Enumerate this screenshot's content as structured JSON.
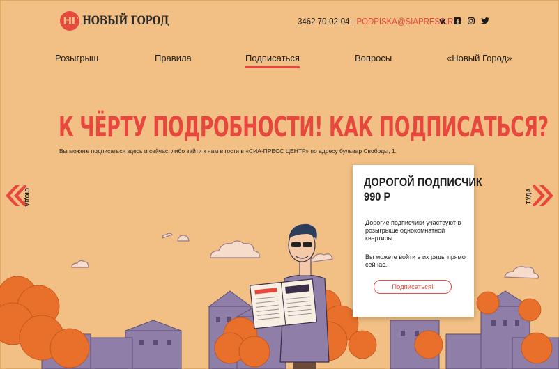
{
  "header": {
    "logo_mark": "НГ",
    "logo_text": "НОВЫЙ ГОРОД",
    "phone": "3462 70-02-04",
    "separator": "|",
    "email": "PODPISKA@SIAPRESS.RU",
    "social": [
      "vk-icon",
      "facebook-icon",
      "instagram-icon",
      "twitter-icon"
    ]
  },
  "nav": {
    "items": [
      {
        "label": "Розыгрыш"
      },
      {
        "label": "Правила"
      },
      {
        "label": "Подписаться",
        "active": true
      },
      {
        "label": "Вопросы"
      },
      {
        "label": "«Новый Город»"
      }
    ]
  },
  "main": {
    "headline": "К ЧЁРТУ ПОДРОБНОСТИ! КАК ПОДПИСАТЬСЯ?",
    "subtext": "Вы можете подписаться здесь и сейчас, либо зайти к нам в гости в «СИА-ПРЕСС ЦЕНТР» по адресу бульвар Свободы, 1."
  },
  "carousel": {
    "left_label": "СЮДА",
    "right_label": "ТУДА"
  },
  "card": {
    "title": "ДОРОГОЙ ПОДПИСЧИК",
    "price": "990 Р",
    "text1": "Дорогие подписчики участвуют в розыгрыше однокомнатной квартиры.",
    "text2": "Вы можете войти в их ряды прямо сейчас.",
    "button": "Подписаться!"
  },
  "colors": {
    "background": "#f2c084",
    "accent": "#e8473e",
    "houses": "#8f7fa8",
    "trees": "#e8702a"
  }
}
